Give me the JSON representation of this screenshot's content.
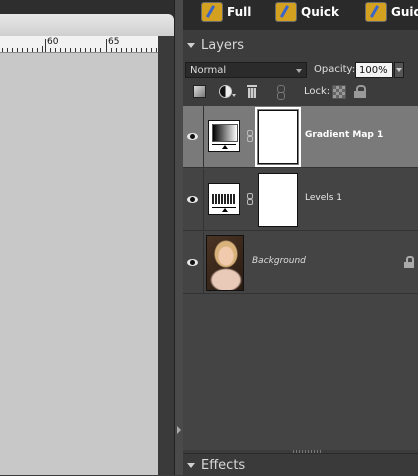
{
  "ruler": {
    "labels": [
      "60",
      "65"
    ]
  },
  "mode_bar": {
    "buttons": [
      "Full",
      "Quick",
      "Guid"
    ]
  },
  "layers_panel": {
    "title": "Layers",
    "blend_mode": "Normal",
    "opacity_label": "Opacity:",
    "opacity_value": "100%",
    "lock_label": "Lock:",
    "layers": [
      {
        "name": "Gradient Map 1",
        "selected": true
      },
      {
        "name": "Levels 1",
        "selected": false
      },
      {
        "name": "Background",
        "selected": false,
        "locked": true
      }
    ]
  },
  "effects_panel": {
    "title": "Effects"
  }
}
